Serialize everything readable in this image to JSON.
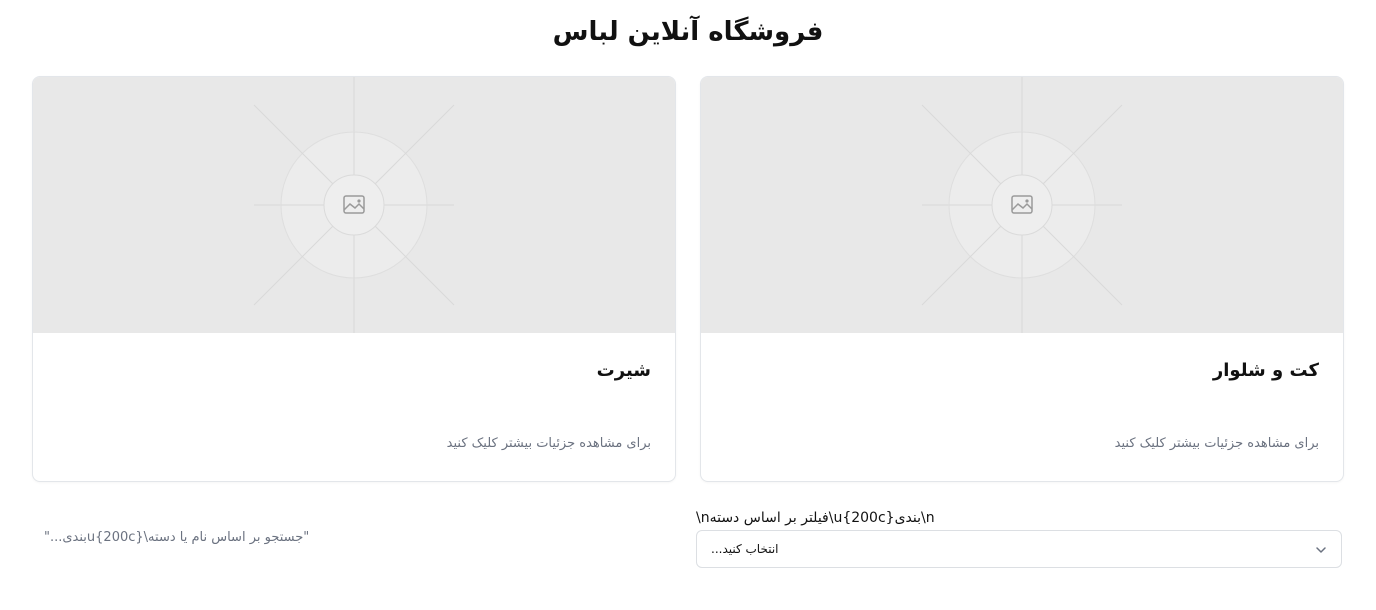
{
  "store": {
    "title": "فروشگاه آنلاین لباس"
  },
  "products": [
    {
      "name": "شیرت",
      "description": "برای مشاهده جزئیات بیشتر کلیک کنید",
      "image_icon": "image-placeholder-icon"
    },
    {
      "name": "کت و شلوار",
      "description": "برای مشاهده جزئیات بیشتر کلیک کنید",
      "image_icon": "image-placeholder-icon"
    }
  ],
  "search": {
    "text": "\"جستجو بر اساس نام یا دسته\\u{200c}بندی...\""
  },
  "filter": {
    "label": "\\nفیلتر بر اساس دسته\\u{200c}بندی\\n",
    "selected": "انتخاب کنید...",
    "icon": "chevron-down-icon"
  }
}
